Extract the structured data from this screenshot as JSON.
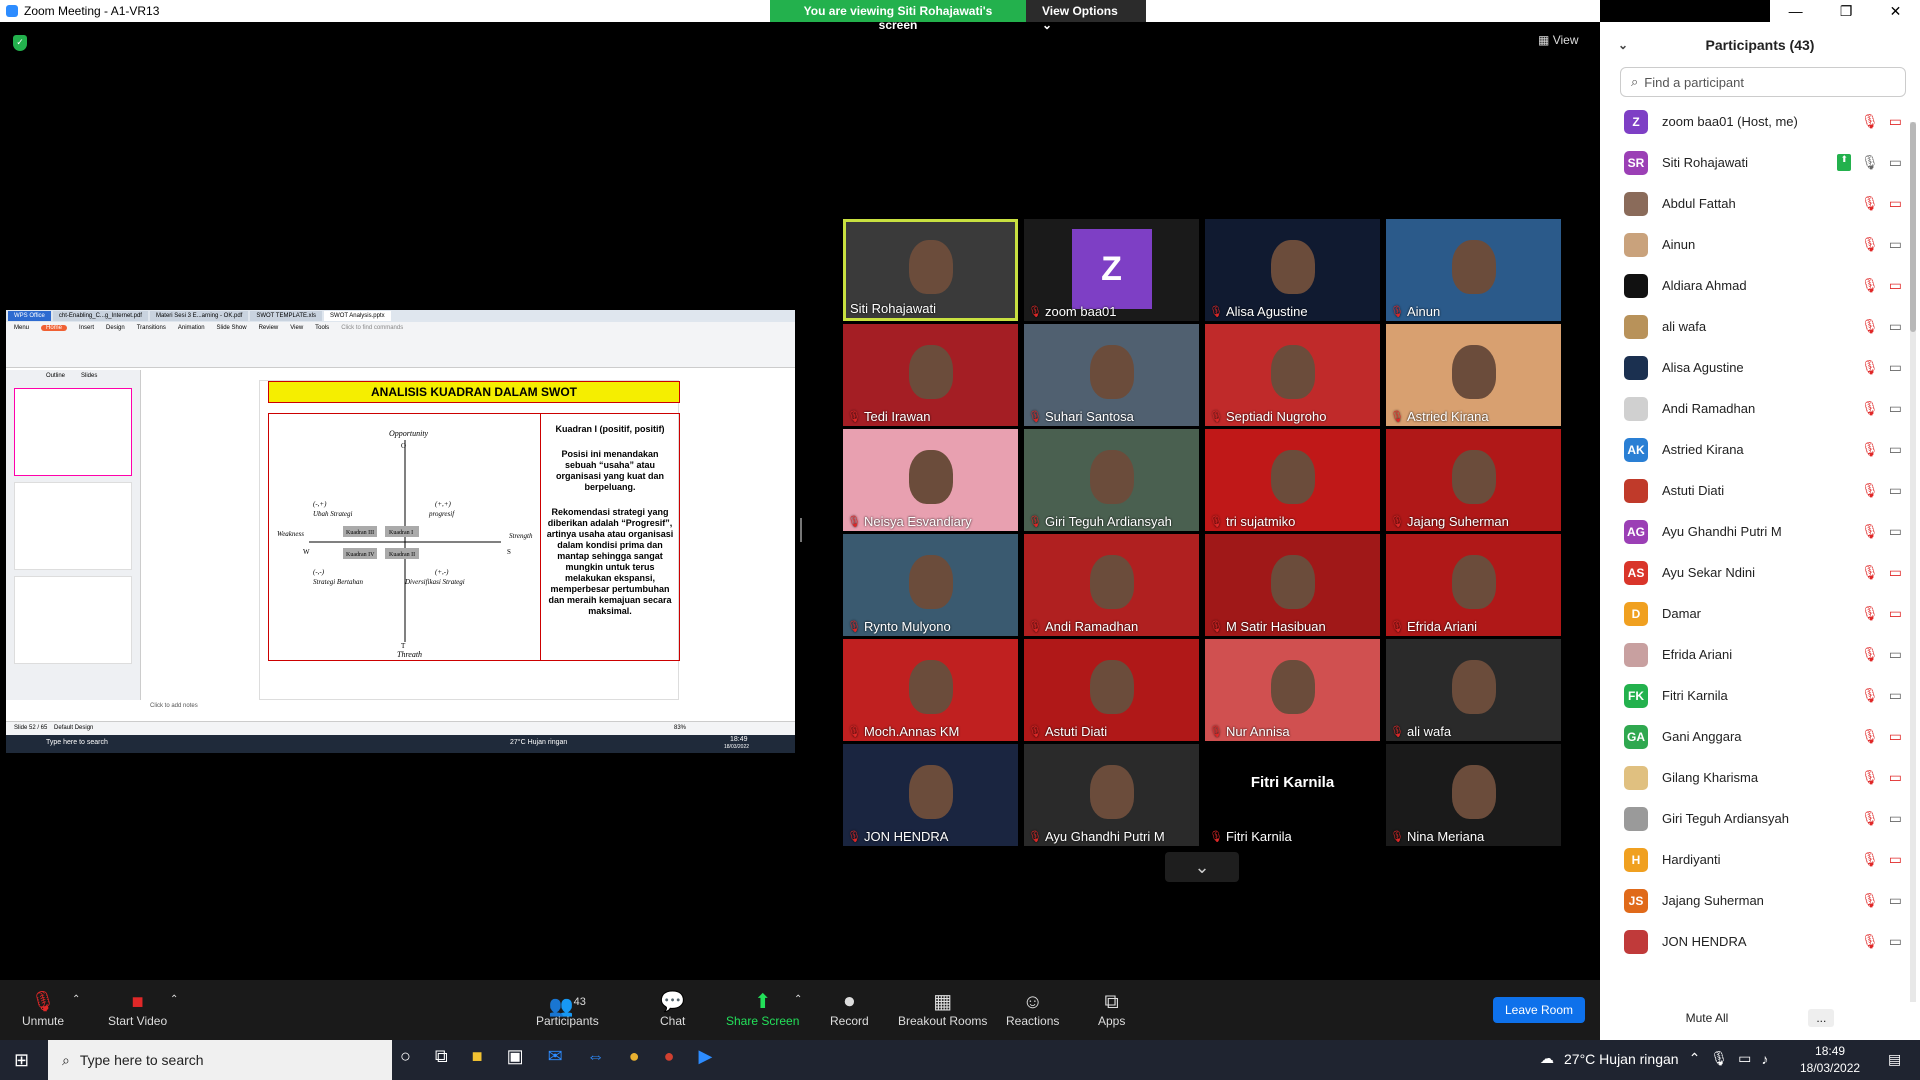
{
  "window": {
    "title": "Zoom Meeting - A1-VR13"
  },
  "share_banner": {
    "viewing_text": "You are viewing Siti Rohajawati's screen",
    "view_options": "View Options"
  },
  "view_button": "View",
  "shared_screen": {
    "tabs": [
      "WPS Office",
      "cht-Enabling_C...g_Internet.pdf",
      "Materi Sesi 3 E...arning - OK.pdf",
      "SWOT TEMPLATE.xls",
      "SWOT Analysis.pptx"
    ],
    "menu": [
      "Menu",
      "Home",
      "Insert",
      "Design",
      "Transitions",
      "Animation",
      "Slide Show",
      "Review",
      "View",
      "Tools",
      "Click to find commands"
    ],
    "panel_tabs": [
      "Outline",
      "Slides"
    ],
    "slide_title": "ANALISIS  KUADRAN DALAM SWOT",
    "diagram": {
      "opportunity": "Opportunity",
      "o": "O",
      "threath": "Threath",
      "t": "T",
      "weakness": "Weakness",
      "w": "W",
      "strength": "Strength",
      "s": "S",
      "q3": "Kuadran III",
      "q1": "Kuadran I",
      "q4": "Kuadran IV",
      "q2": "Kuadran II",
      "tl_sign": "(-,+)",
      "tl_label": "Ubah Strategi",
      "tr_sign": "(+,+)",
      "tr_label": "progresif",
      "bl_sign": "(-,-)",
      "bl_label": "Strategi Bertahan",
      "br_sign": "(+,-)",
      "br_label": "Diversifikasi Strategi"
    },
    "text_heading": "Kuadran I (positif, positif)",
    "text_p1": "Posisi ini menandakan sebuah “usaha” atau organisasi yang kuat dan berpeluang.",
    "text_p2": "Rekomendasi strategi yang diberikan adalah “Progresif”, artinya usaha atau organisasi dalam kondisi prima dan mantap sehingga sangat mungkin untuk terus melakukan ekspansi, memperbesar pertumbuhan dan meraih kemajuan secara maksimal.",
    "notes": "Click to add notes",
    "status_left": "Slide 52 / 65",
    "status_theme": "Default Design",
    "zoom": "83%",
    "taskbar_search": "Type here to search",
    "weather": "27°C  Hujan ringan",
    "time": "18:49",
    "date": "18/03/2022"
  },
  "video_tiles": [
    {
      "name": "Siti Rohajawati",
      "muted": false,
      "active": true
    },
    {
      "name": "zoom baa01",
      "muted": true,
      "initial": "Z"
    },
    {
      "name": "Alisa Agustine",
      "muted": true
    },
    {
      "name": "Ainun",
      "muted": true
    },
    {
      "name": "Tedi Irawan",
      "muted": true
    },
    {
      "name": "Suhari Santosa",
      "muted": true
    },
    {
      "name": "Septiadi Nugroho",
      "muted": true
    },
    {
      "name": "Astried Kirana",
      "muted": true
    },
    {
      "name": "Neisya Esvandiary",
      "muted": true
    },
    {
      "name": "Giri Teguh Ardiansyah",
      "muted": true
    },
    {
      "name": "tri sujatmiko",
      "muted": true
    },
    {
      "name": "Jajang Suherman",
      "muted": true
    },
    {
      "name": "Rynto Mulyono",
      "muted": true
    },
    {
      "name": "Andi Ramadhan",
      "muted": true
    },
    {
      "name": "M Satir Hasibuan",
      "muted": true
    },
    {
      "name": "Efrida Ariani",
      "muted": true
    },
    {
      "name": "Moch.Annas KM",
      "muted": true
    },
    {
      "name": "Astuti Diati",
      "muted": true
    },
    {
      "name": "Nur Annisa",
      "muted": true
    },
    {
      "name": "ali wafa",
      "muted": true
    },
    {
      "name": "JON HENDRA",
      "muted": true
    },
    {
      "name": "Ayu Ghandhi Putri M",
      "muted": true
    },
    {
      "name": "Fitri Karnila",
      "muted": true,
      "big": "Fitri Karnila"
    },
    {
      "name": "Nina Meriana",
      "muted": true
    }
  ],
  "participants": {
    "title": "Participants (43)",
    "search_placeholder": "Find a participant",
    "list": [
      {
        "name": "zoom baa01 (Host, me)",
        "initials": "Z",
        "color": "#7e3fc5",
        "video_off": true
      },
      {
        "name": "Siti Rohajawati",
        "initials": "SR",
        "color": "#9b3fb5",
        "sharing": true,
        "video_off": false
      },
      {
        "name": "Abdul Fattah",
        "initials": "",
        "color": "#8a6b5a",
        "video_off": true
      },
      {
        "name": "Ainun",
        "initials": "",
        "color": "#c9a27c",
        "video_off": false
      },
      {
        "name": "Aldiara Ahmad",
        "initials": "",
        "color": "#111111",
        "video_off": true
      },
      {
        "name": "ali wafa",
        "initials": "",
        "color": "#b8925a",
        "video_off": false
      },
      {
        "name": "Alisa Agustine",
        "initials": "",
        "color": "#1b3050",
        "video_off": false
      },
      {
        "name": "Andi Ramadhan",
        "initials": "",
        "color": "#d0d0d0",
        "video_off": false
      },
      {
        "name": "Astried Kirana",
        "initials": "AK",
        "color": "#2a7fd4",
        "video_off": false
      },
      {
        "name": "Astuti Diati",
        "initials": "",
        "color": "#c03a2a",
        "video_off": false
      },
      {
        "name": "Ayu Ghandhi Putri M",
        "initials": "AG",
        "color": "#9b3fb5",
        "video_off": false
      },
      {
        "name": "Ayu Sekar Ndini",
        "initials": "AS",
        "color": "#d9352a",
        "video_off": true
      },
      {
        "name": "Damar",
        "initials": "D",
        "color": "#f0a020",
        "video_off": true
      },
      {
        "name": "Efrida Ariani",
        "initials": "",
        "color": "#c8a0a0",
        "video_off": false
      },
      {
        "name": "Fitri Karnila",
        "initials": "FK",
        "color": "#23b14d",
        "video_off": false
      },
      {
        "name": "Gani Anggara",
        "initials": "GA",
        "color": "#2fa84f",
        "video_off": true
      },
      {
        "name": "Gilang Kharisma",
        "initials": "",
        "color": "#e0c080",
        "video_off": true
      },
      {
        "name": "Giri Teguh Ardiansyah",
        "initials": "",
        "color": "#9a9a9a",
        "video_off": false
      },
      {
        "name": "Hardiyanti",
        "initials": "H",
        "color": "#f0a020",
        "video_off": true
      },
      {
        "name": "Jajang Suherman",
        "initials": "JS",
        "color": "#e06a1a",
        "video_off": false
      },
      {
        "name": "JON HENDRA",
        "initials": "",
        "color": "#c03a3a",
        "video_off": false
      }
    ],
    "mute_all": "Mute All",
    "more": "..."
  },
  "toolbar": {
    "unmute": "Unmute",
    "start_video": "Start Video",
    "participants": "Participants",
    "participants_count": "43",
    "chat": "Chat",
    "share_screen": "Share Screen",
    "record": "Record",
    "breakout": "Breakout Rooms",
    "reactions": "Reactions",
    "apps": "Apps",
    "leave": "Leave Room"
  },
  "taskbar": {
    "search": "Type here to search",
    "weather": "27°C  Hujan ringan",
    "time": "18:49",
    "date": "18/03/2022"
  }
}
